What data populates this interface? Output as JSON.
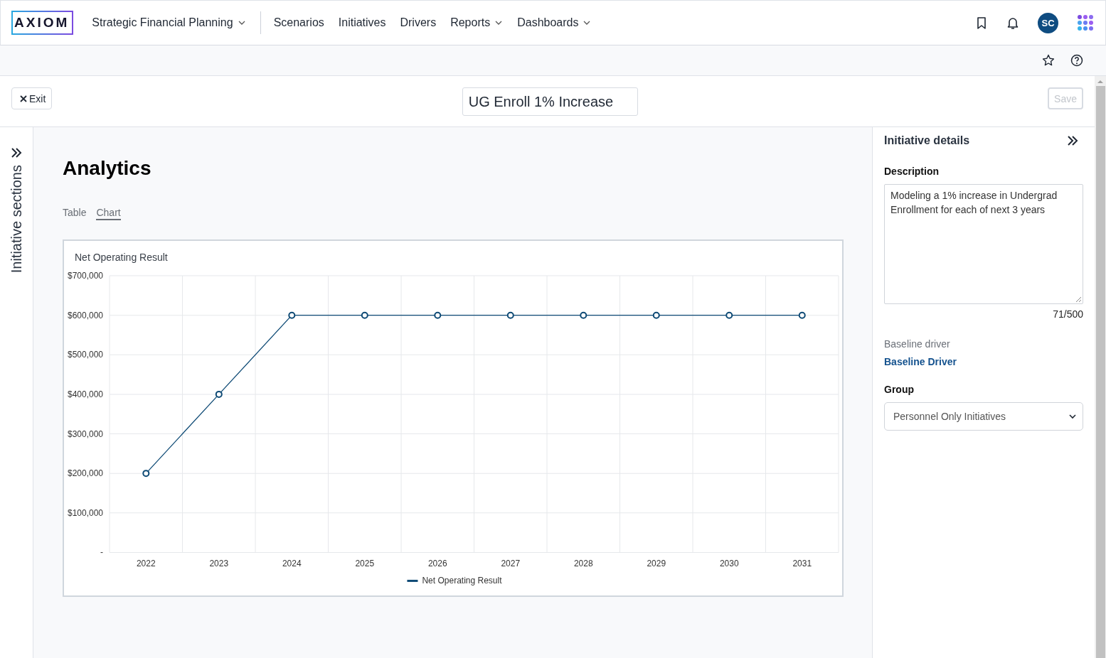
{
  "header": {
    "logo": "AXIOM",
    "app_menu": {
      "label": "Strategic Financial Planning",
      "dropdown": true
    },
    "nav": [
      {
        "label": "Scenarios",
        "dropdown": false
      },
      {
        "label": "Initiatives",
        "dropdown": false
      },
      {
        "label": "Drivers",
        "dropdown": false
      },
      {
        "label": "Reports",
        "dropdown": true
      },
      {
        "label": "Dashboards",
        "dropdown": true
      }
    ],
    "avatar": "SC"
  },
  "edit_bar": {
    "exit": "Exit",
    "title": "UG Enroll 1% Increase",
    "save": {
      "label": "Save",
      "disabled": true
    }
  },
  "left_rail": {
    "label": "Initiative sections"
  },
  "main": {
    "heading": "Analytics",
    "views": [
      {
        "label": "Table",
        "selected": false
      },
      {
        "label": "Chart",
        "selected": true
      }
    ],
    "chart_data": {
      "type": "line",
      "title": "Net Operating Result",
      "categories": [
        "2022",
        "2023",
        "2024",
        "2025",
        "2026",
        "2027",
        "2028",
        "2029",
        "2030",
        "2031"
      ],
      "grid": true,
      "series": [
        {
          "name": "Net Operating Result",
          "color": "#0e4a75",
          "marker": true,
          "values": [
            200000,
            400000,
            600000,
            600000,
            600000,
            600000,
            600000,
            600000,
            600000,
            600000
          ]
        }
      ],
      "ylim": [
        0,
        700000
      ],
      "yticks": [
        {
          "value": 0,
          "label": "-"
        },
        {
          "value": 100000,
          "label": "$100,000"
        },
        {
          "value": 200000,
          "label": "$200,000"
        },
        {
          "value": 300000,
          "label": "$300,000"
        },
        {
          "value": 400000,
          "label": "$400,000"
        },
        {
          "value": 500000,
          "label": "$500,000"
        },
        {
          "value": 600000,
          "label": "$600,000"
        },
        {
          "value": 700000,
          "label": "$700,000"
        }
      ]
    }
  },
  "details": {
    "title": "Initiative details",
    "description_label": "Description",
    "description": "Modeling a 1% increase in Undergrad Enrollment for each of next 3 years",
    "counter": "71/500",
    "baseline_label": "Baseline driver",
    "baseline_link": "Baseline Driver",
    "group_label": "Group",
    "group_value": "Personnel Only Initiatives"
  }
}
